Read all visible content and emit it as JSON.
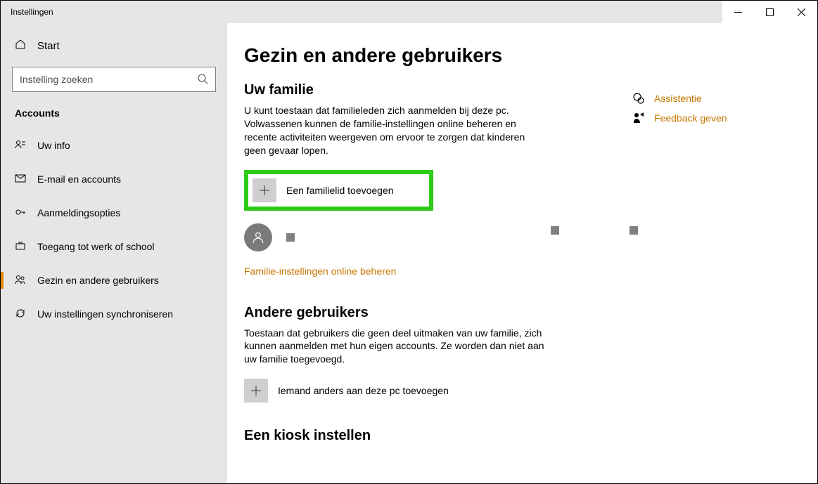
{
  "window": {
    "title": "Instellingen"
  },
  "sidebar": {
    "start_label": "Start",
    "search_placeholder": "Instelling zoeken",
    "section_label": "Accounts",
    "items": [
      {
        "label": "Uw info"
      },
      {
        "label": "E-mail en accounts"
      },
      {
        "label": "Aanmeldingsopties"
      },
      {
        "label": "Toegang tot werk of school"
      },
      {
        "label": "Gezin en andere gebruikers"
      },
      {
        "label": "Uw instellingen synchroniseren"
      }
    ]
  },
  "main": {
    "title": "Gezin en andere gebruikers",
    "family": {
      "heading": "Uw familie",
      "description": "U kunt toestaan dat familieleden zich aanmelden bij deze pc. Volwassenen kunnen de familie-instellingen online beheren en recente activiteiten weergeven om ervoor te zorgen dat kinderen geen gevaar lopen.",
      "add_member_label": "Een familielid toevoegen",
      "manage_link": "Familie-instellingen online beheren"
    },
    "others": {
      "heading": "Andere gebruikers",
      "description": "Toestaan dat gebruikers die geen deel uitmaken van uw familie, zich kunnen aanmelden met hun eigen accounts. Ze worden dan niet aan uw familie toegevoegd.",
      "add_other_label": "Iemand anders aan deze pc toevoegen"
    },
    "kiosk": {
      "heading": "Een kiosk instellen"
    }
  },
  "aside": {
    "help_label": "Assistentie",
    "feedback_label": "Feedback geven"
  }
}
